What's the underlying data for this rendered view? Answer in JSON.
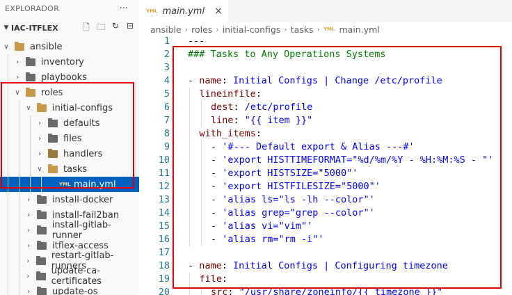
{
  "sidebar": {
    "title": "EXPLORADOR",
    "more": "···",
    "project": "IAC-ITFLEX",
    "tree": [
      {
        "label": "ansible",
        "depth": 0,
        "open": true,
        "type": "folder"
      },
      {
        "label": "inventory",
        "depth": 1,
        "open": false,
        "type": "folder"
      },
      {
        "label": "playbooks",
        "depth": 1,
        "open": false,
        "type": "folder"
      },
      {
        "label": "roles",
        "depth": 1,
        "open": true,
        "type": "folder"
      },
      {
        "label": "initial-configs",
        "depth": 2,
        "open": true,
        "type": "folder"
      },
      {
        "label": "defaults",
        "depth": 3,
        "open": false,
        "type": "folder"
      },
      {
        "label": "files",
        "depth": 3,
        "open": false,
        "type": "folder"
      },
      {
        "label": "handlers",
        "depth": 3,
        "open": false,
        "type": "folder-special"
      },
      {
        "label": "tasks",
        "depth": 3,
        "open": true,
        "type": "folder"
      },
      {
        "label": "main.yml",
        "depth": 4,
        "open": false,
        "type": "yml",
        "selected": true
      },
      {
        "label": "install-docker",
        "depth": 2,
        "open": false,
        "type": "folder"
      },
      {
        "label": "install-fail2ban",
        "depth": 2,
        "open": false,
        "type": "folder"
      },
      {
        "label": "install-gitlab-runner",
        "depth": 2,
        "open": false,
        "type": "folder"
      },
      {
        "label": "itflex-access",
        "depth": 2,
        "open": false,
        "type": "folder"
      },
      {
        "label": "restart-gitlab-runners",
        "depth": 2,
        "open": false,
        "type": "folder"
      },
      {
        "label": "update-ca-certificates",
        "depth": 2,
        "open": false,
        "type": "folder"
      },
      {
        "label": "update-os",
        "depth": 2,
        "open": false,
        "type": "folder"
      }
    ]
  },
  "editor": {
    "tab": {
      "icon": "yml",
      "name": "main.yml",
      "close": "×"
    },
    "breadcrumb": [
      "ansible",
      "roles",
      "initial-configs",
      "tasks",
      "main.yml"
    ],
    "lines": [
      {
        "n": "1",
        "tokens": [
          {
            "t": "---",
            "c": "p"
          }
        ],
        "indent": 0
      },
      {
        "n": "2",
        "tokens": [
          {
            "t": "### Tasks to Any Operations Systems",
            "c": "c"
          }
        ],
        "indent": 0
      },
      {
        "n": "3",
        "tokens": [],
        "indent": 0
      },
      {
        "n": "4",
        "tokens": [
          {
            "t": "- ",
            "c": "p"
          },
          {
            "t": "name",
            "c": "k"
          },
          {
            "t": ": ",
            "c": "p"
          },
          {
            "t": "Initial Configs | Change /etc/profile",
            "c": "s"
          }
        ],
        "indent": 0
      },
      {
        "n": "5",
        "tokens": [
          {
            "t": "lineinfile",
            "c": "k"
          },
          {
            "t": ":",
            "c": "p"
          }
        ],
        "indent": 1
      },
      {
        "n": "6",
        "tokens": [
          {
            "t": "dest",
            "c": "k"
          },
          {
            "t": ": ",
            "c": "p"
          },
          {
            "t": "/etc/profile",
            "c": "s"
          }
        ],
        "indent": 2
      },
      {
        "n": "7",
        "tokens": [
          {
            "t": "line",
            "c": "k"
          },
          {
            "t": ": ",
            "c": "p"
          },
          {
            "t": "\"{{ item }}\"",
            "c": "s"
          }
        ],
        "indent": 2
      },
      {
        "n": "8",
        "tokens": [
          {
            "t": "with_items",
            "c": "k"
          },
          {
            "t": ":",
            "c": "p"
          }
        ],
        "indent": 1
      },
      {
        "n": "9",
        "tokens": [
          {
            "t": "- ",
            "c": "p"
          },
          {
            "t": "'#--- Default export & Alias ---#'",
            "c": "s"
          }
        ],
        "indent": 2
      },
      {
        "n": "10",
        "tokens": [
          {
            "t": "- ",
            "c": "p"
          },
          {
            "t": "'export HISTTIMEFORMAT=\"%d/%m/%Y - %H:%M:%S - \"'",
            "c": "s"
          }
        ],
        "indent": 2
      },
      {
        "n": "11",
        "tokens": [
          {
            "t": "- ",
            "c": "p"
          },
          {
            "t": "'export HISTSIZE=\"5000\"'",
            "c": "s"
          }
        ],
        "indent": 2
      },
      {
        "n": "12",
        "tokens": [
          {
            "t": "- ",
            "c": "p"
          },
          {
            "t": "'export HISTFILESIZE=\"5000\"'",
            "c": "s"
          }
        ],
        "indent": 2
      },
      {
        "n": "13",
        "tokens": [
          {
            "t": "- ",
            "c": "p"
          },
          {
            "t": "'alias ls=\"ls -lh --color\"'",
            "c": "s"
          }
        ],
        "indent": 2
      },
      {
        "n": "14",
        "tokens": [
          {
            "t": "- ",
            "c": "p"
          },
          {
            "t": "'alias grep=\"grep --color\"'",
            "c": "s"
          }
        ],
        "indent": 2
      },
      {
        "n": "15",
        "tokens": [
          {
            "t": "- ",
            "c": "p"
          },
          {
            "t": "'alias vi=\"vim\"'",
            "c": "s"
          }
        ],
        "indent": 2
      },
      {
        "n": "16",
        "tokens": [
          {
            "t": "- ",
            "c": "p"
          },
          {
            "t": "'alias rm=\"rm -i\"'",
            "c": "s"
          }
        ],
        "indent": 2
      },
      {
        "n": "17",
        "tokens": [],
        "indent": 0
      },
      {
        "n": "18",
        "tokens": [
          {
            "t": "- ",
            "c": "p"
          },
          {
            "t": "name",
            "c": "k"
          },
          {
            "t": ": ",
            "c": "p"
          },
          {
            "t": "Initial Configs | Configuring timezone",
            "c": "s"
          }
        ],
        "indent": 0
      },
      {
        "n": "19",
        "tokens": [
          {
            "t": "file",
            "c": "k"
          },
          {
            "t": ":",
            "c": "p"
          }
        ],
        "indent": 1
      },
      {
        "n": "20",
        "tokens": [
          {
            "t": "src",
            "c": "k"
          },
          {
            "t": ": ",
            "c": "p"
          },
          {
            "t": "\"/usr/share/zoneinfo/{{ timezone }}\"",
            "c": "s"
          }
        ],
        "indent": 2
      }
    ]
  },
  "colors": {
    "highlight": "#e00000",
    "selection": "#0060c0"
  }
}
